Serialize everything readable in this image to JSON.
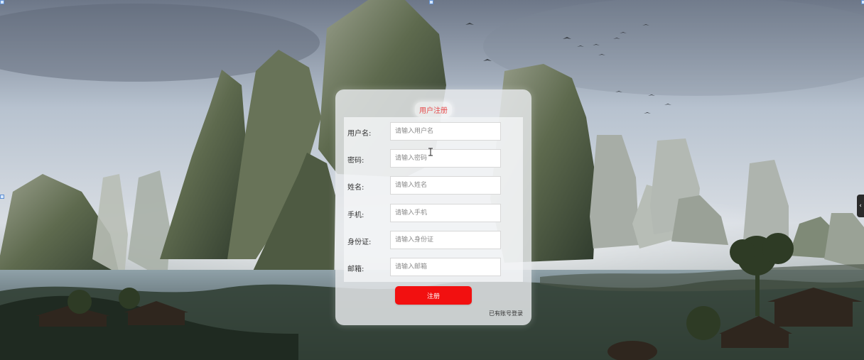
{
  "page": {
    "title": "用户注册"
  },
  "form": {
    "fields": [
      {
        "label": "用户名:",
        "placeholder": "请输入用户名",
        "value": ""
      },
      {
        "label": "密码:",
        "placeholder": "请输入密码",
        "value": ""
      },
      {
        "label": "姓名:",
        "placeholder": "请输入姓名",
        "value": ""
      },
      {
        "label": "手机:",
        "placeholder": "请输入手机",
        "value": ""
      },
      {
        "label": "身份证:",
        "placeholder": "请输入身份证",
        "value": ""
      },
      {
        "label": "邮箱:",
        "placeholder": "请输入邮箱",
        "value": ""
      }
    ],
    "register_label": "注册",
    "login_link": "已有账号登录"
  },
  "theme": {
    "title_color": "#e64a4a",
    "button_color": "#f21010"
  },
  "icons": {
    "text_cursor": "text-cursor-icon",
    "edge_arrow": "chevron-left-icon"
  }
}
